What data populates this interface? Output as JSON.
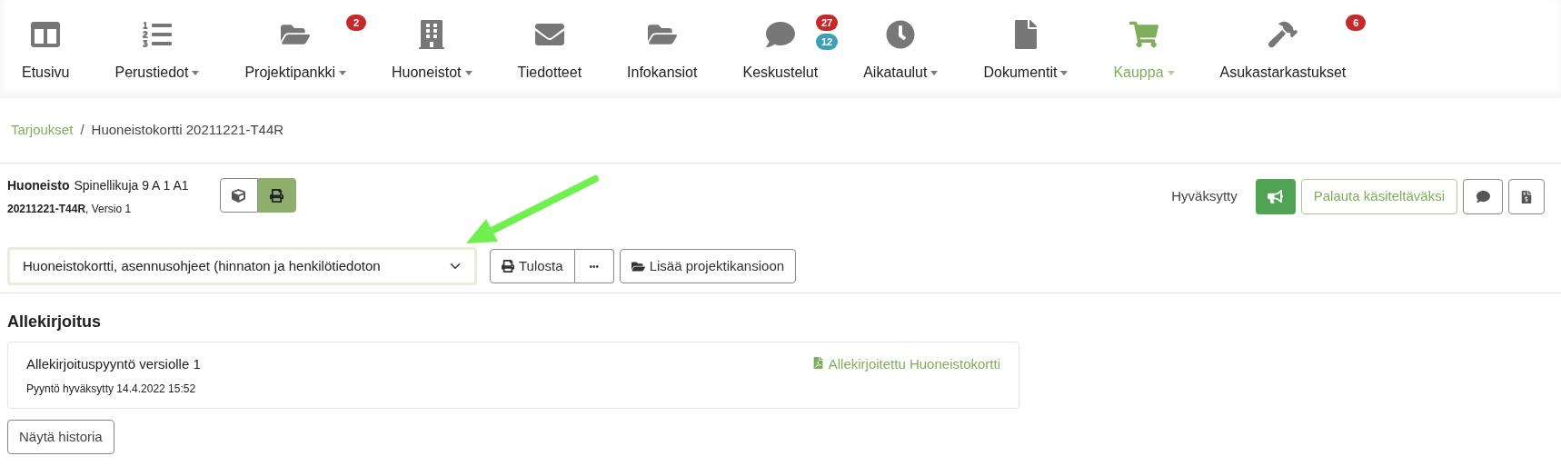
{
  "nav": [
    {
      "label": "Etusivu",
      "has_menu": false,
      "selected": false
    },
    {
      "label": "Perustiedot",
      "has_menu": true,
      "selected": false
    },
    {
      "label": "Projektipankki",
      "has_menu": true,
      "selected": false,
      "badges": [
        {
          "text": "2",
          "color": "#c52a2a"
        }
      ]
    },
    {
      "label": "Huoneistot",
      "has_menu": true,
      "selected": false
    },
    {
      "label": "Tiedotteet",
      "has_menu": false,
      "selected": false
    },
    {
      "label": "Infokansiot",
      "has_menu": false,
      "selected": false
    },
    {
      "label": "Keskustelut",
      "has_menu": false,
      "selected": false,
      "badges": [
        {
          "text": "27",
          "color": "#c52a2a"
        },
        {
          "text": "12",
          "color": "#3f9fb5"
        }
      ]
    },
    {
      "label": "Aikataulut",
      "has_menu": true,
      "selected": false
    },
    {
      "label": "Dokumentit",
      "has_menu": true,
      "selected": false
    },
    {
      "label": "Kauppa",
      "has_menu": true,
      "selected": true
    },
    {
      "label": "Asukastarkastukset",
      "has_menu": false,
      "selected": false,
      "badges": [
        {
          "text": "6",
          "color": "#c52a2a"
        }
      ]
    }
  ],
  "breadcrumb": {
    "link": "Tarjoukset",
    "separator": "/",
    "current": "Huoneistokortti 20211221-T44R"
  },
  "header": {
    "title_bold": "Huoneisto",
    "title": "Spinellikuja 9 A 1 A1",
    "code": "20211221-T44R",
    "version": ", Versio 1",
    "view_toggle": [
      {
        "selected": false
      },
      {
        "selected": true
      }
    ],
    "status": "Hyväksytty",
    "return_button": "Palauta käsiteltäväksi"
  },
  "toolbar": {
    "template_select": "Huoneistokortti, asennusohjeet (hinnaton ja henkilötiedoton",
    "print_button": "Tulosta",
    "more_button": "•••",
    "add_button": "Lisää projektikansioon"
  },
  "signature": {
    "heading": "Allekirjoitus",
    "request_title": "Allekirjoituspyyntö versiolle 1",
    "request_status": "Pyyntö hyväksytty 14.4.2022 15:52",
    "document_link": "Allekirjoitettu Huoneistokortti",
    "history_button": "Näytä historia"
  }
}
